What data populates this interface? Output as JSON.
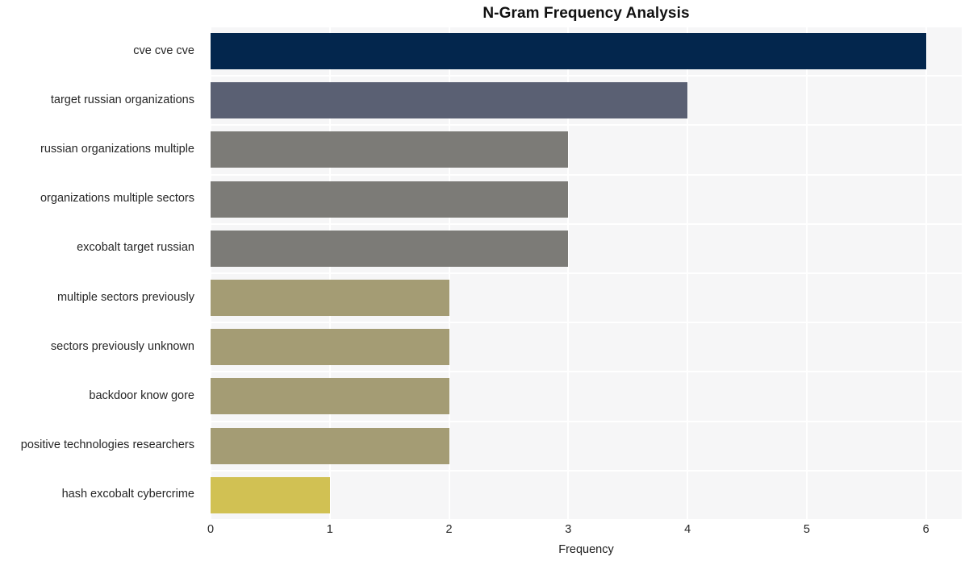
{
  "chart_data": {
    "type": "bar",
    "orientation": "horizontal",
    "title": "N-Gram Frequency Analysis",
    "xlabel": "Frequency",
    "ylabel": "",
    "categories": [
      "cve cve cve",
      "target russian organizations",
      "russian organizations multiple",
      "organizations multiple sectors",
      "excobalt target russian",
      "multiple sectors previously",
      "sectors previously unknown",
      "backdoor know gore",
      "positive technologies researchers",
      "hash excobalt cybercrime"
    ],
    "values": [
      6,
      4,
      3,
      3,
      3,
      2,
      2,
      2,
      2,
      1
    ],
    "bar_colors": [
      "#03264d",
      "#5a6073",
      "#7c7b77",
      "#7c7b77",
      "#7c7b77",
      "#a49c74",
      "#a49c74",
      "#a49c74",
      "#a49c74",
      "#d1c153"
    ],
    "xlim": [
      0,
      6.3
    ],
    "xticks": [
      0,
      1,
      2,
      3,
      4,
      5,
      6
    ],
    "xtick_labels": [
      "0",
      "1",
      "2",
      "3",
      "4",
      "5",
      "6"
    ],
    "grid": true,
    "grid_color": "#ffffff",
    "plot_background": "#f6f6f7",
    "figure_background": "#ffffff",
    "legend": null
  }
}
